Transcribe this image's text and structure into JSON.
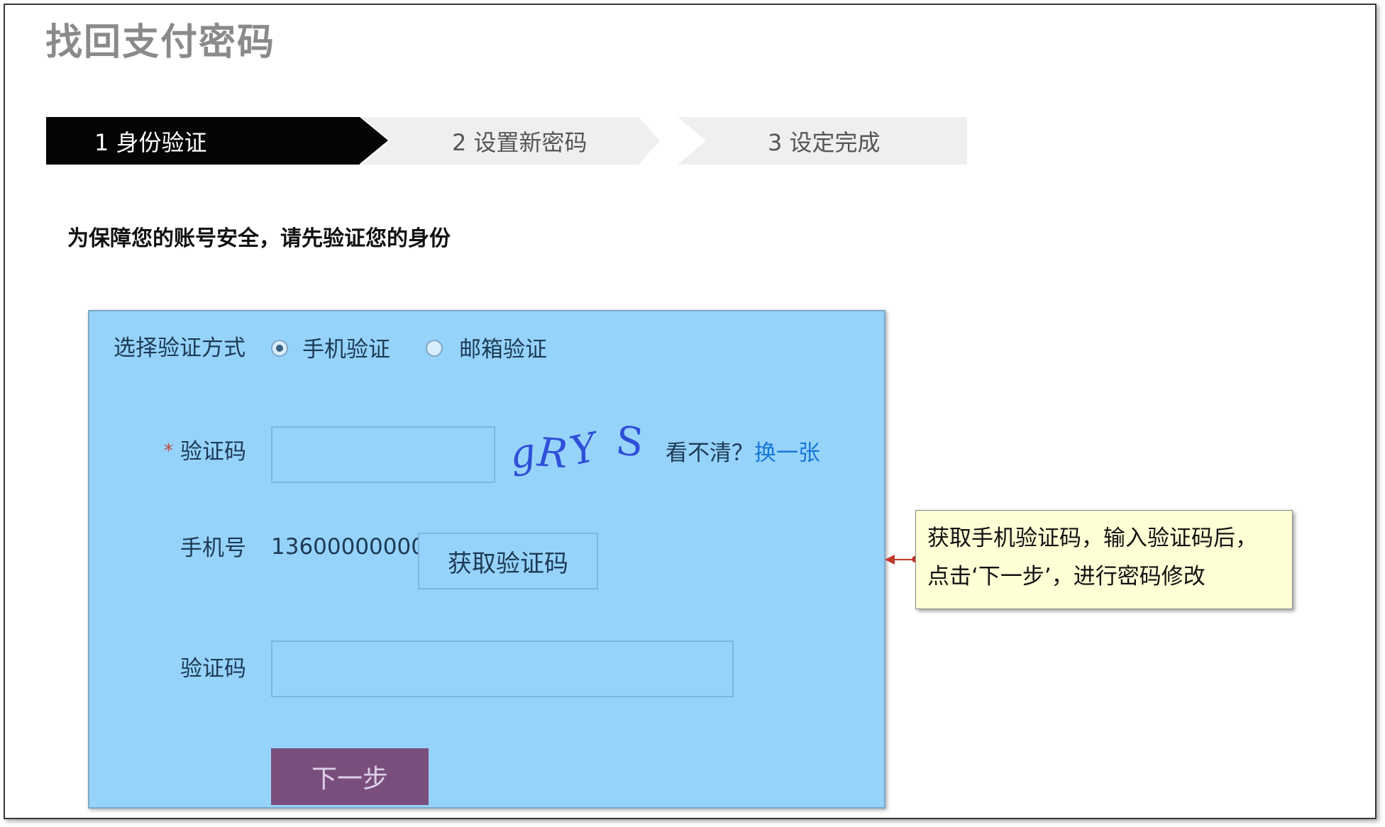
{
  "page": {
    "title": "找回支付密码",
    "notice": "为保障您的账号安全，请先验证您的身份"
  },
  "steps": [
    {
      "label": "1 身份验证",
      "active": true
    },
    {
      "label": "2 设置新密码",
      "active": false
    },
    {
      "label": "3 设定完成",
      "active": false
    }
  ],
  "form": {
    "method_label": "选择验证方式",
    "methods": [
      {
        "label": "手机验证",
        "checked": true
      },
      {
        "label": "邮箱验证",
        "checked": false
      }
    ],
    "captcha": {
      "required_mark": "*",
      "label": "验证码",
      "input_value": "",
      "image_text": [
        "g",
        "R",
        "Y",
        "S"
      ],
      "unclear_text": "看不清？",
      "refresh_link": "换一张"
    },
    "phone": {
      "label": "手机号",
      "value": "13600000000",
      "get_code_button": "获取验证码"
    },
    "sms_code": {
      "label": "验证码",
      "input_value": ""
    },
    "next_button": "下一步"
  },
  "callout": {
    "line1": "获取手机验证码，输入验证码后，",
    "line2": "点击‘下一步’，进行密码修改"
  },
  "colors": {
    "panel_bg": "#96d3fb",
    "next_button_bg": "#7a4e7c",
    "link": "#1778d8",
    "callout_bg": "#ffffd6",
    "step_active_bg": "#050505"
  }
}
